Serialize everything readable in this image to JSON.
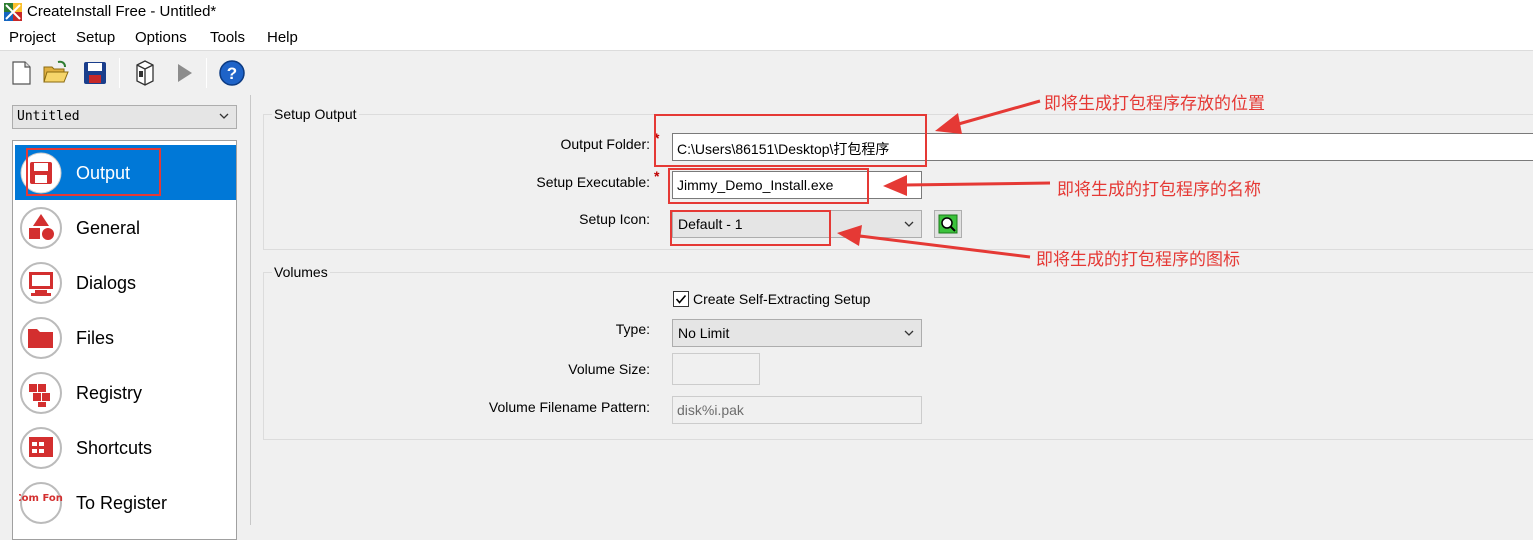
{
  "window": {
    "title": "CreateInstall Free - Untitled*"
  },
  "menu": [
    "Project",
    "Setup",
    "Options",
    "Tools",
    "Help"
  ],
  "toolbar": {
    "icons": [
      "new-file-icon",
      "open-folder-icon",
      "save-disk-icon",
      "build-package-icon",
      "run-play-icon",
      "help-icon"
    ]
  },
  "project_selector": {
    "value": "Untitled"
  },
  "nav": {
    "items": [
      {
        "label": "Output",
        "icon": "floppy-disk-icon",
        "active": true
      },
      {
        "label": "General",
        "icon": "shapes-icon",
        "active": false
      },
      {
        "label": "Dialogs",
        "icon": "monitor-icon",
        "active": false
      },
      {
        "label": "Files",
        "icon": "folder-icon",
        "active": false
      },
      {
        "label": "Registry",
        "icon": "registry-cubes-icon",
        "active": false
      },
      {
        "label": "Shortcuts",
        "icon": "shortcut-grid-icon",
        "active": false
      },
      {
        "label": "To Register",
        "icon": "com-font-icon",
        "active": false
      }
    ],
    "register_icon_text": "Com Font"
  },
  "setup_output": {
    "group_title": "Setup Output",
    "output_folder_label": "Output Folder:",
    "output_folder_value": "C:\\Users\\86151\\Desktop\\打包程序",
    "setup_executable_label": "Setup Executable:",
    "setup_executable_value": "Jimmy_Demo_Install.exe",
    "setup_icon_label": "Setup Icon:",
    "setup_icon_value": "Default - 1",
    "required_mark": "*"
  },
  "volumes": {
    "group_title": "Volumes",
    "self_extract_label": "Create Self-Extracting Setup",
    "self_extract_checked": true,
    "type_label": "Type:",
    "type_value": "No Limit",
    "volume_size_label": "Volume Size:",
    "volume_size_value": "",
    "filename_pattern_label": "Volume Filename Pattern:",
    "filename_pattern_value": "disk%i.pak"
  },
  "annotations": {
    "folder_note": "即将生成打包程序存放的位置",
    "exe_note": "即将生成的打包程序的名称",
    "icon_note": "即将生成的打包程序的图标"
  },
  "colors": {
    "accent": "#0078d7",
    "annotation": "#e53935",
    "required": "#c00000"
  }
}
